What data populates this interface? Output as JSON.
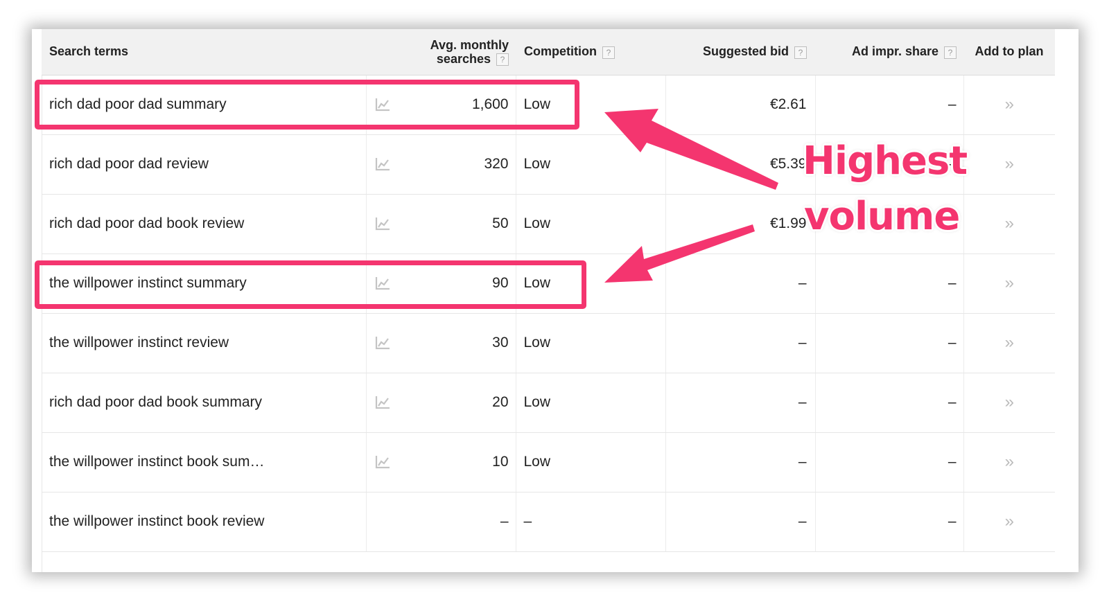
{
  "headers": {
    "search_terms": "Search terms",
    "avg_line1": "Avg. monthly",
    "avg_line2": "searches",
    "competition": "Competition",
    "suggested_bid": "Suggested bid",
    "ad_impr_share": "Ad impr. share",
    "add_to_plan": "Add to plan",
    "help": "?"
  },
  "rows": [
    {
      "term": "rich dad poor dad summary",
      "chart": true,
      "searches": "1,600",
      "competition": "Low",
      "bid": "€2.61",
      "share": "–",
      "add": "»"
    },
    {
      "term": "rich dad poor dad review",
      "chart": true,
      "searches": "320",
      "competition": "Low",
      "bid": "€5.39",
      "share": "–",
      "add": "»"
    },
    {
      "term": "rich dad poor dad book review",
      "chart": true,
      "searches": "50",
      "competition": "Low",
      "bid": "€1.99",
      "share": "–",
      "add": "»"
    },
    {
      "term": "the willpower instinct summary",
      "chart": true,
      "searches": "90",
      "competition": "Low",
      "bid": "–",
      "share": "–",
      "add": "»"
    },
    {
      "term": "the willpower instinct review",
      "chart": true,
      "searches": "30",
      "competition": "Low",
      "bid": "–",
      "share": "–",
      "add": "»"
    },
    {
      "term": "rich dad poor dad book summary",
      "chart": true,
      "searches": "20",
      "competition": "Low",
      "bid": "–",
      "share": "–",
      "add": "»"
    },
    {
      "term": "the willpower instinct book sum…",
      "chart": true,
      "searches": "10",
      "competition": "Low",
      "bid": "–",
      "share": "–",
      "add": "»"
    },
    {
      "term": "the willpower instinct book review",
      "chart": false,
      "searches": "–",
      "competition": "–",
      "bid": "–",
      "share": "–",
      "add": "»"
    }
  ],
  "annotation": {
    "line1": "Highest",
    "line2": "volume",
    "color": "#f4356f"
  }
}
